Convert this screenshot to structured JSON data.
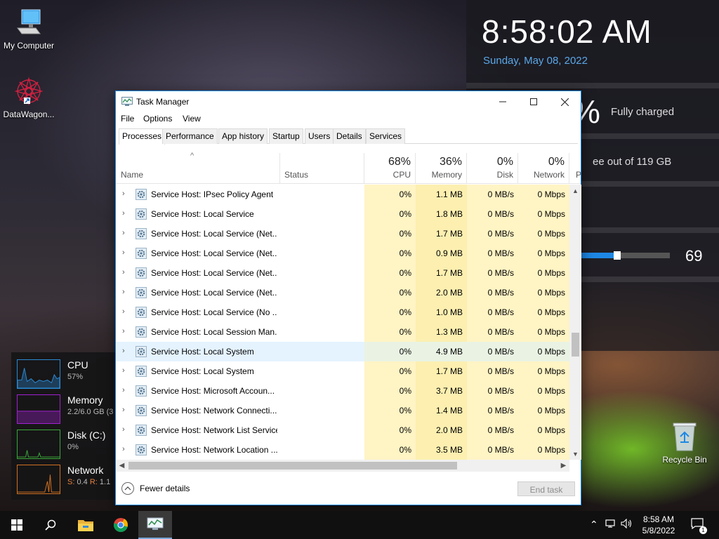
{
  "desktop": {
    "icons": [
      {
        "label": "My Computer"
      },
      {
        "label": "DataWagon..."
      }
    ],
    "recycle_bin": "Recycle Bin"
  },
  "info_panel": {
    "time": "8:58:02 AM",
    "date": "Sunday, May 08, 2022",
    "battery_symbol": "%",
    "battery_status": "Fully charged",
    "disk_status": "ee out of 119 GB",
    "volume_level": 69,
    "volume_fraction": 0.4,
    "date_color": "#5aa8e8",
    "volume_color": "#1e88e5"
  },
  "perf_widget": {
    "cpu": {
      "title": "CPU",
      "value": "57%",
      "color": "#2a8ad4"
    },
    "memory": {
      "title": "Memory",
      "value": "2.2/6.0 GB (3",
      "color": "#a020d0"
    },
    "disk": {
      "title": "Disk (C:)",
      "value": "0%",
      "color": "#3aa83a"
    },
    "network": {
      "title": "Network",
      "s_label": "S:",
      "s_value": "0.4",
      "r_label": "R:",
      "r_value": "1.1",
      "color": "#d07020"
    }
  },
  "task_manager": {
    "title": "Task Manager",
    "menu": [
      "File",
      "Options",
      "View"
    ],
    "tabs": [
      "Processes",
      "Performance",
      "App history",
      "Startup",
      "Users",
      "Details",
      "Services"
    ],
    "active_tab": "Processes",
    "header": {
      "name": "Name",
      "status": "Status",
      "cpu_pct": "68%",
      "cpu": "CPU",
      "memory_pct": "36%",
      "memory": "Memory",
      "disk_pct": "0%",
      "disk": "Disk",
      "network_pct": "0%",
      "network": "Network",
      "extra": "P"
    },
    "rows": [
      {
        "name": "Service Host: IPsec Policy Agent",
        "cpu": "0%",
        "memory": "1.1 MB",
        "disk": "0 MB/s",
        "network": "0 Mbps"
      },
      {
        "name": "Service Host: Local Service",
        "cpu": "0%",
        "memory": "1.8 MB",
        "disk": "0 MB/s",
        "network": "0 Mbps"
      },
      {
        "name": "Service Host: Local Service (Net...",
        "cpu": "0%",
        "memory": "1.7 MB",
        "disk": "0 MB/s",
        "network": "0 Mbps"
      },
      {
        "name": "Service Host: Local Service (Net...",
        "cpu": "0%",
        "memory": "0.9 MB",
        "disk": "0 MB/s",
        "network": "0 Mbps"
      },
      {
        "name": "Service Host: Local Service (Net...",
        "cpu": "0%",
        "memory": "1.7 MB",
        "disk": "0 MB/s",
        "network": "0 Mbps"
      },
      {
        "name": "Service Host: Local Service (Net...",
        "cpu": "0%",
        "memory": "2.0 MB",
        "disk": "0 MB/s",
        "network": "0 Mbps"
      },
      {
        "name": "Service Host: Local Service (No ...",
        "cpu": "0%",
        "memory": "1.0 MB",
        "disk": "0 MB/s",
        "network": "0 Mbps"
      },
      {
        "name": "Service Host: Local Session Man...",
        "cpu": "0%",
        "memory": "1.3 MB",
        "disk": "0 MB/s",
        "network": "0 Mbps"
      },
      {
        "name": "Service Host: Local System",
        "cpu": "0%",
        "memory": "4.9 MB",
        "disk": "0 MB/s",
        "network": "0 Mbps",
        "selected": true
      },
      {
        "name": "Service Host: Local System",
        "cpu": "0%",
        "memory": "1.7 MB",
        "disk": "0 MB/s",
        "network": "0 Mbps"
      },
      {
        "name": "Service Host: Microsoft Accoun...",
        "cpu": "0%",
        "memory": "3.7 MB",
        "disk": "0 MB/s",
        "network": "0 Mbps"
      },
      {
        "name": "Service Host: Network Connecti...",
        "cpu": "0%",
        "memory": "1.4 MB",
        "disk": "0 MB/s",
        "network": "0 Mbps"
      },
      {
        "name": "Service Host: Network List Service",
        "cpu": "0%",
        "memory": "2.0 MB",
        "disk": "0 MB/s",
        "network": "0 Mbps"
      },
      {
        "name": "Service Host: Network Location ...",
        "cpu": "0%",
        "memory": "3.5 MB",
        "disk": "0 MB/s",
        "network": "0 Mbps"
      }
    ],
    "footer": {
      "fewer_details": "Fewer details",
      "end_task": "End task"
    }
  },
  "taskbar": {
    "time": "8:58 AM",
    "date": "5/8/2022",
    "notification_count": "1",
    "items": [
      "start-icon",
      "search-icon",
      "file-explorer-icon",
      "chrome-icon",
      "task-manager-icon"
    ]
  }
}
